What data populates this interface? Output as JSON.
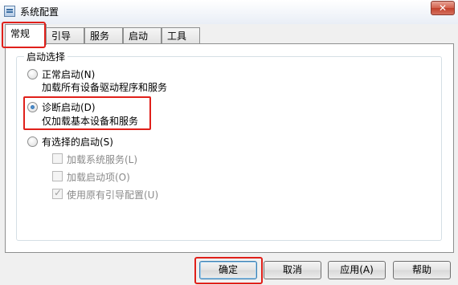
{
  "window": {
    "title": "系统配置",
    "close_label": "✕"
  },
  "tabs": [
    {
      "label": "常规",
      "active": true
    },
    {
      "label": "引导"
    },
    {
      "label": "服务"
    },
    {
      "label": "启动"
    },
    {
      "label": "工具"
    }
  ],
  "startup_group": {
    "legend": "启动选择",
    "options": [
      {
        "label": "正常启动(N)",
        "description": "加载所有设备驱动程序和服务",
        "checked": false
      },
      {
        "label": "诊断启动(D)",
        "description": "仅加载基本设备和服务",
        "checked": true
      },
      {
        "label": "有选择的启动(S)",
        "checked": false
      }
    ],
    "selective_items": [
      {
        "label": "加载系统服务(L)",
        "checked": false
      },
      {
        "label": "加载启动项(O)",
        "checked": false
      },
      {
        "label": "使用原有引导配置(U)",
        "checked": true
      }
    ]
  },
  "buttons": {
    "ok": "确定",
    "cancel": "取消",
    "apply": "应用(A)",
    "help": "帮助"
  },
  "colors": {
    "highlight": "#e0201a",
    "disabled_text": "#8a8a8a"
  }
}
